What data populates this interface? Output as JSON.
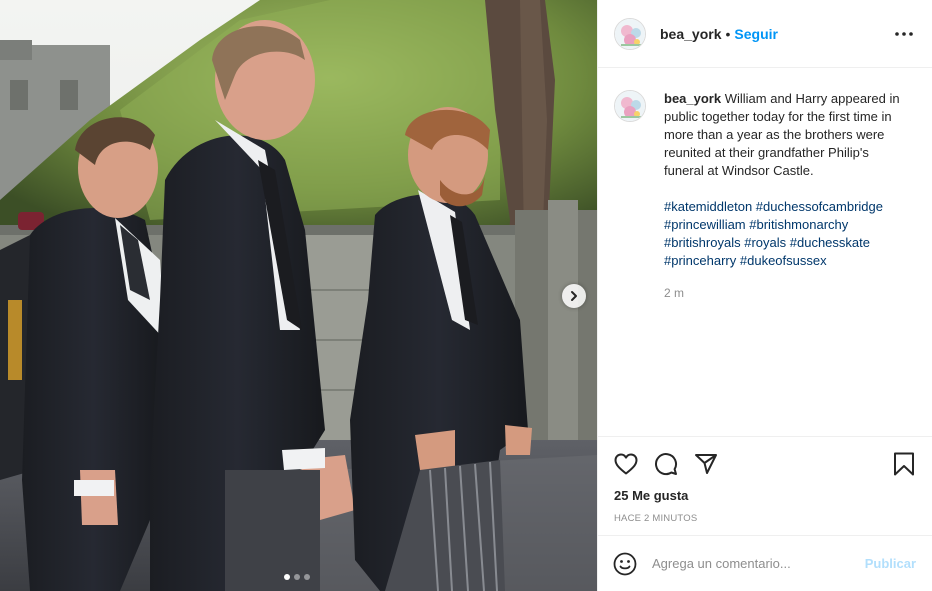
{
  "post": {
    "username": "bea_york",
    "separator": "•",
    "follow_label": "Seguir",
    "caption": "William and Harry appeared in public together today for the first time in more than a year as the brothers were reunited at their grandfather Philip's funeral at Windsor Castle.",
    "hashtags": [
      "#katemiddleton",
      "#duchessofcambridge",
      "#princewilliam",
      "#britishmonarchy",
      "#britishroyals",
      "#royals",
      "#duchesskate",
      "#princeharry",
      "#dukeofsussex"
    ],
    "time_short": "2 m",
    "likes_text": "25 Me gusta",
    "time_ago": "HACE 2 MINUTOS"
  },
  "comment_box": {
    "placeholder": "Agrega un comentario...",
    "publish_label": "Publicar"
  },
  "carousel": {
    "slide_count": 3,
    "active_index": 0
  },
  "icons": {
    "more": "more-options-icon",
    "like": "heart-icon",
    "comment": "comment-bubble-icon",
    "share": "paper-plane-icon",
    "save": "bookmark-icon",
    "emoji": "emoji-icon",
    "next": "chevron-right-icon"
  },
  "colors": {
    "accent": "#0095f6",
    "publish_disabled": "#b2dffc",
    "hashtag": "#00376b",
    "muted": "#8e8e8e"
  }
}
